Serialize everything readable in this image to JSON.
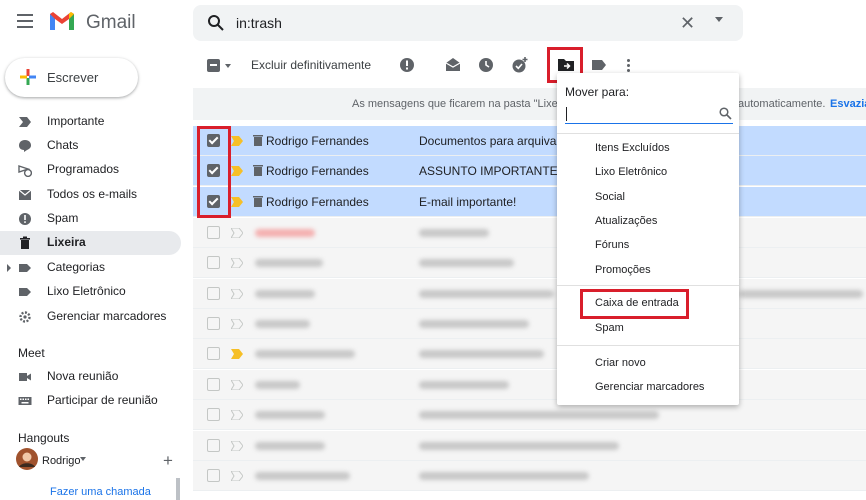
{
  "app": {
    "name": "Gmail"
  },
  "search": {
    "value": "in:trash"
  },
  "compose": {
    "label": "Escrever"
  },
  "sidebar": {
    "items": [
      {
        "label": "Importante",
        "icon": "label-important-icon"
      },
      {
        "label": "Chats",
        "icon": "chat-icon"
      },
      {
        "label": "Programados",
        "icon": "schedule-send-icon"
      },
      {
        "label": "Todos os e-mails",
        "icon": "all-mail-icon"
      },
      {
        "label": "Spam",
        "icon": "spam-icon"
      },
      {
        "label": "Lixeira",
        "icon": "trash-icon",
        "active": true
      },
      {
        "label": "Categorias",
        "icon": "category-icon"
      },
      {
        "label": "Lixo Eletrônico",
        "icon": "label-icon"
      },
      {
        "label": "Gerenciar marcadores",
        "icon": "gear-icon"
      }
    ],
    "meet": {
      "title": "Meet",
      "items": [
        {
          "label": "Nova reunião",
          "icon": "video-icon"
        },
        {
          "label": "Participar de reunião",
          "icon": "keyboard-icon"
        }
      ]
    },
    "hangouts": {
      "title": "Hangouts",
      "user": "Rodrigo",
      "call_link": "Fazer uma chamada"
    }
  },
  "toolbar": {
    "delete_forever_label": "Excluir definitivamente"
  },
  "banner": {
    "text": "As mensagens que ficarem na pasta \"Lixei",
    "tail": "automaticamente.",
    "link": "Esvazia"
  },
  "emails": [
    {
      "sender": "Rodrigo Fernandes",
      "subject": "Documentos para arquivar",
      "selected": true
    },
    {
      "sender": "Rodrigo Fernandes",
      "subject": "ASSUNTO IMPORTANTE!",
      "selected": true
    },
    {
      "sender": "Rodrigo Fernandes",
      "subject": "E-mail importante!",
      "selected": true
    }
  ],
  "move_to": {
    "title": "Mover para:",
    "items": [
      "Itens Excluídos",
      "Lixo Eletrônico",
      "Social",
      "Atualizações",
      "Fóruns",
      "Promoções"
    ],
    "inbox": "Caixa de entrada",
    "spam": "Spam",
    "create_new": "Criar novo",
    "manage_labels": "Gerenciar marcadores"
  },
  "colors": {
    "accent": "#1a73e8",
    "selected_row": "#c2dbff",
    "highlight": "#d91e2b",
    "important": "#f6bf26"
  }
}
